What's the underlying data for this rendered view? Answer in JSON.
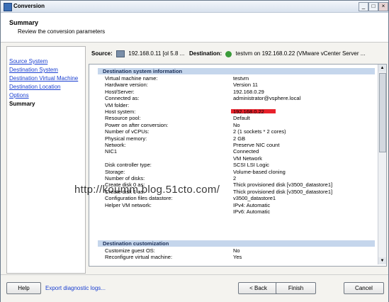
{
  "window": {
    "title": "Conversion",
    "min_icon": "_",
    "max_icon": "□",
    "close_icon": "×"
  },
  "header": {
    "title": "Summary",
    "subtitle": "Review the conversion parameters"
  },
  "nav": {
    "items": [
      {
        "label": "Source System",
        "current": false
      },
      {
        "label": "Destination System",
        "current": false
      },
      {
        "label": "Destination Virtual Machine",
        "current": false
      },
      {
        "label": "Destination Location",
        "current": false
      },
      {
        "label": "Options",
        "current": false
      },
      {
        "label": "Summary",
        "current": true
      }
    ]
  },
  "sourcebar": {
    "source_label": "Source:",
    "source_value": "192.168.0.11 [ol 5.8 ...",
    "dest_label": "Destination:",
    "dest_value": "testvm on 192.168.0.22 (VMware vCenter Server ..."
  },
  "sections": [
    {
      "title": "Destination system information",
      "rows": [
        {
          "k": "Virtual machine name:",
          "v": "testvm"
        },
        {
          "k": "Hardware version:",
          "v": "Version 11"
        },
        {
          "k": "Host/Server:",
          "v": "192.168.0.29"
        },
        {
          "k": "Connected as:",
          "v": "administrator@vsphere.local"
        },
        {
          "k": "VM folder:",
          "v": ""
        },
        {
          "k": "Host system:",
          "v": "192.168.0.22"
        },
        {
          "k": "Resource pool:",
          "v": "Default"
        },
        {
          "k": "Power on after conversion:",
          "v": "No"
        },
        {
          "k": "Number of vCPUs:",
          "v": "2 (1 sockets * 2 cores)"
        },
        {
          "k": "Physical memory:",
          "v": "2 GB"
        },
        {
          "k": "Network:",
          "v": "Preserve NIC count"
        },
        {
          "k": "NIC1",
          "v": "Connected"
        },
        {
          "k": "",
          "v": "VM Network"
        },
        {
          "k": "Disk controller type:",
          "v": "SCSI LSI Logic"
        },
        {
          "k": "Storage:",
          "v": "Volume-based cloning"
        },
        {
          "k": "Number of disks:",
          "v": "2"
        },
        {
          "k": "Create disk 0 as:",
          "v": "Thick provisioned disk [v3500_datastore1]"
        },
        {
          "k": "Create disk 1 as:",
          "v": "Thick provisioned disk [v3500_datastore1]"
        },
        {
          "k": "Configuration files datastore:",
          "v": "v3500_datastore1"
        },
        {
          "k": "Helper VM network:",
          "v": "IPv4: Automatic"
        },
        {
          "k": "",
          "v": "IPv6: Automatic"
        }
      ]
    },
    {
      "title": "Destination customization",
      "rows": [
        {
          "k": "Customize guest OS:",
          "v": "No"
        },
        {
          "k": "Reconfigure virtual machine:",
          "v": "Yes"
        }
      ]
    }
  ],
  "watermark": "http://koumm.blog.51cto.com/",
  "scroll": {
    "up": "▲",
    "down": "▼"
  },
  "footer": {
    "help": "Help",
    "export": "Export diagnostic logs...",
    "back": "< Back",
    "finish": "Finish",
    "cancel": "Cancel"
  },
  "colors": {
    "link": "#1a3fd1",
    "section_head": "#c5d6ec",
    "redaction": "#e8212b"
  }
}
